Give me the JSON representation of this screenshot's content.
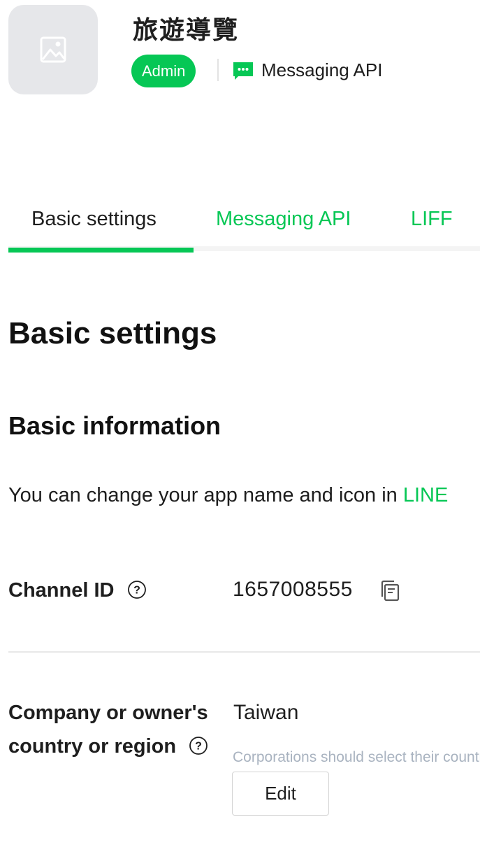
{
  "header": {
    "app_icon": "image-placeholder-icon",
    "app_name": "旅遊導覽",
    "role_badge": "Admin",
    "channel_icon": "chat-bubble-icon",
    "channel_type": "Messaging API"
  },
  "tabs": [
    {
      "label": "Basic settings",
      "active": true
    },
    {
      "label": "Messaging API",
      "active": false
    },
    {
      "label": "LIFF",
      "active": false
    }
  ],
  "main": {
    "page_title": "Basic settings",
    "section_title": "Basic information",
    "section_desc": {
      "text": "You can change your app name and icon in ",
      "link_text": "LINE"
    },
    "fields": {
      "channel_id": {
        "label": "Channel ID",
        "value": "1657008555",
        "help_icon": "question-circle-icon",
        "copy_icon": "copy-icon"
      },
      "country": {
        "label": "Company or owner's country or region",
        "value": "Taiwan",
        "note": "Corporations should select their country",
        "edit_label": "Edit",
        "help_icon": "question-circle-icon"
      }
    }
  },
  "colors": {
    "brand_green": "#06c755",
    "text": "#1e1e1e",
    "muted": "#a9b3c0",
    "icon_bg": "#e6e7ea"
  }
}
